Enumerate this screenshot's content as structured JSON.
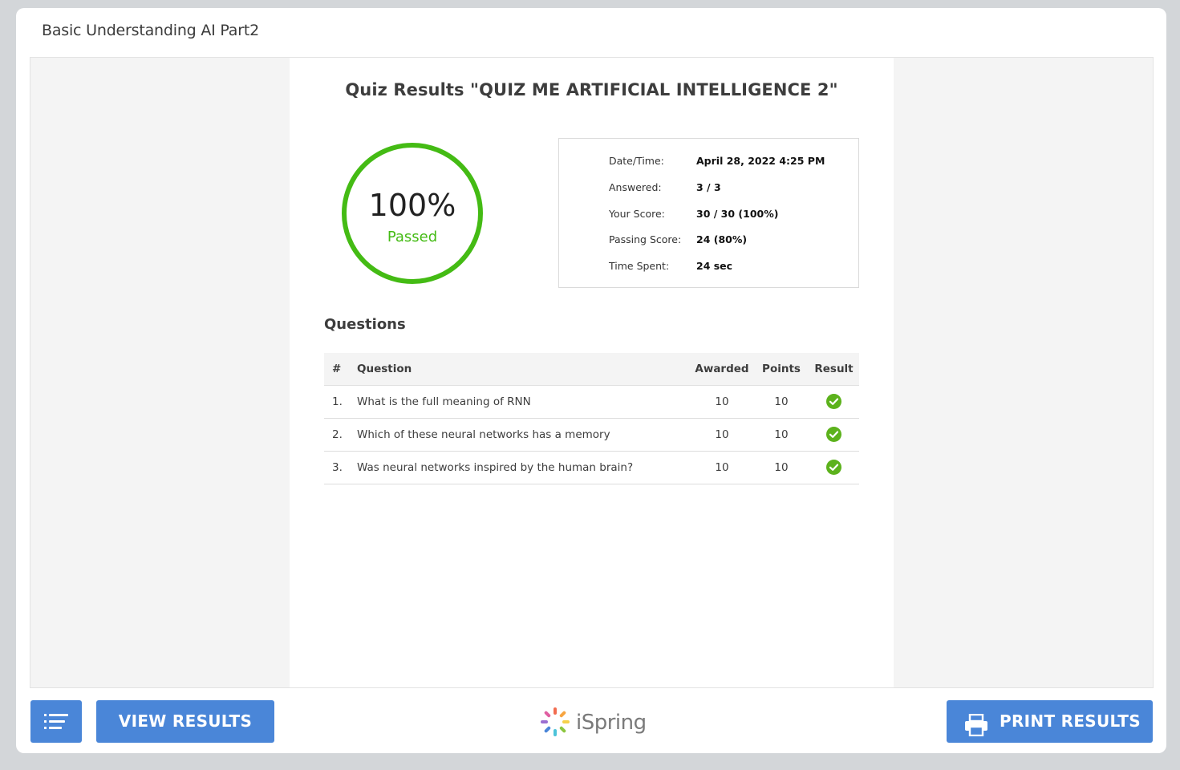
{
  "window": {
    "title": "Basic Understanding AI Part2"
  },
  "quiz": {
    "title": "Quiz Results \"QUIZ ME ARTIFICIAL INTELLIGENCE 2\"",
    "score_percent": "100%",
    "status": "Passed",
    "colors": {
      "accent": "#44bb14",
      "button": "#4a86d8"
    }
  },
  "summary": [
    {
      "label": "Date/Time:",
      "value": "April 28, 2022 4:25 PM"
    },
    {
      "label": "Answered:",
      "value": "3 / 3"
    },
    {
      "label": "Your Score:",
      "value": "30 / 30 (100%)"
    },
    {
      "label": "Passing Score:",
      "value": "24 (80%)"
    },
    {
      "label": "Time Spent:",
      "value": "24 sec"
    }
  ],
  "questions": {
    "heading": "Questions",
    "columns": [
      "#",
      "Question",
      "Awarded",
      "Points",
      "Result"
    ],
    "rows": [
      {
        "num": "1.",
        "question": "What is the full meaning of RNN",
        "awarded": "10",
        "points": "10",
        "result": "correct"
      },
      {
        "num": "2.",
        "question": "Which of these neural networks has a memory",
        "awarded": "10",
        "points": "10",
        "result": "correct"
      },
      {
        "num": "3.",
        "question": "Was neural networks inspired by the human brain?",
        "awarded": "10",
        "points": "10",
        "result": "correct"
      }
    ]
  },
  "footer": {
    "menu_icon": "list-icon",
    "view_results": "VIEW RESULTS",
    "brand": "iSpring",
    "print_icon": "printer-icon",
    "print_results": "PRINT RESULTS"
  }
}
